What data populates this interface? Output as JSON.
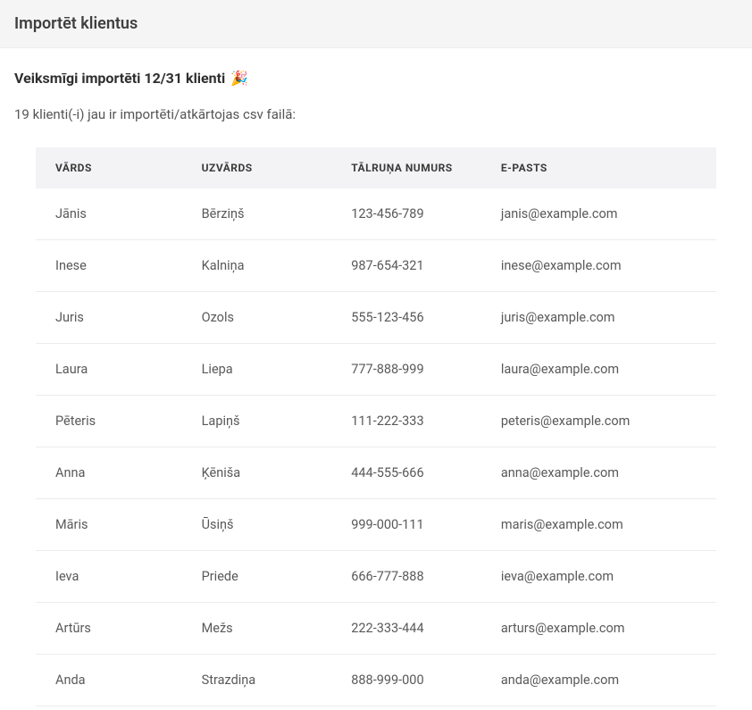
{
  "header": {
    "title": "Importēt klientus"
  },
  "status": {
    "success_text": "Veiksmīgi importēti 12/31 klienti",
    "emoji": "🎉",
    "duplicates_text": "19 klienti(-i) jau ir importēti/atkārtojas csv failā:"
  },
  "table": {
    "headers": {
      "first_name": "VĀRDS",
      "last_name": "UZVĀRDS",
      "phone": "TĀLRUŅA NUMURS",
      "email": "E-PASTS"
    },
    "rows": [
      {
        "first_name": "Jānis",
        "last_name": "Bērziņš",
        "phone": "123-456-789",
        "email": "janis@example.com"
      },
      {
        "first_name": "Inese",
        "last_name": "Kalniņa",
        "phone": "987-654-321",
        "email": "inese@example.com"
      },
      {
        "first_name": "Juris",
        "last_name": "Ozols",
        "phone": "555-123-456",
        "email": "juris@example.com"
      },
      {
        "first_name": "Laura",
        "last_name": "Liepa",
        "phone": "777-888-999",
        "email": "laura@example.com"
      },
      {
        "first_name": "Pēteris",
        "last_name": "Lapiņš",
        "phone": "111-222-333",
        "email": "peteris@example.com"
      },
      {
        "first_name": "Anna",
        "last_name": "Ķēniša",
        "phone": "444-555-666",
        "email": "anna@example.com"
      },
      {
        "first_name": "Māris",
        "last_name": "Ūsiņš",
        "phone": "999-000-111",
        "email": "maris@example.com"
      },
      {
        "first_name": "Ieva",
        "last_name": "Priede",
        "phone": "666-777-888",
        "email": "ieva@example.com"
      },
      {
        "first_name": "Artūrs",
        "last_name": "Mežs",
        "phone": "222-333-444",
        "email": "arturs@example.com"
      },
      {
        "first_name": "Anda",
        "last_name": "Strazdiņa",
        "phone": "888-999-000",
        "email": "anda@example.com"
      }
    ]
  }
}
